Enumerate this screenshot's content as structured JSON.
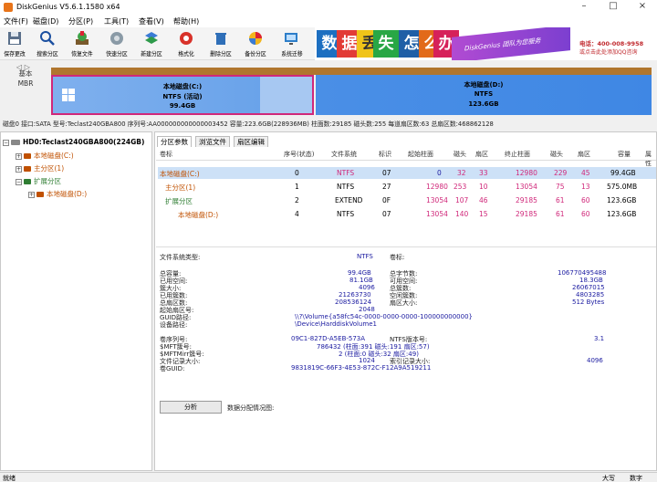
{
  "window": {
    "title": "DiskGenius V5.6.1.1580 x64",
    "minimize": "–",
    "maximize": "□",
    "close": "×"
  },
  "menu": [
    "文件(F)",
    "磁盘(D)",
    "分区(P)",
    "工具(T)",
    "查看(V)",
    "帮助(H)"
  ],
  "toolbar": [
    {
      "label": "保存更改",
      "icon": "save-icon"
    },
    {
      "label": "搜索分区",
      "icon": "search-icon"
    },
    {
      "label": "恢复文件",
      "icon": "recover-icon"
    },
    {
      "label": "快速分区",
      "icon": "quick-partition-icon"
    },
    {
      "label": "新建分区",
      "icon": "new-partition-icon"
    },
    {
      "label": "格式化",
      "icon": "format-icon"
    },
    {
      "label": "删除分区",
      "icon": "delete-icon"
    },
    {
      "label": "备份分区",
      "icon": "backup-icon"
    },
    {
      "label": "系统迁移",
      "icon": "migrate-icon"
    }
  ],
  "banner": {
    "tiles": [
      "数",
      "据",
      "丢",
      "失",
      "怎",
      "么",
      "办"
    ],
    "tile_colors": [
      "#1c6fc1",
      "#e23b36",
      "#f0c419",
      "#28a745",
      "#1f5fa6",
      "#e26a1a",
      "#d6215a"
    ],
    "slogan": "DiskGenius 团队为您服务",
    "phone": "电话：400-008-9958",
    "note": "或点击此处添加QQ咨询"
  },
  "diskmap": {
    "label_lines": [
      "基本",
      "MBR"
    ],
    "partitions": [
      {
        "name": "本地磁盘(C:)",
        "fs": "NTFS (活动)",
        "size": "99.4GB"
      },
      {
        "name": "本地磁盘(D:)",
        "fs": "NTFS",
        "size": "123.6GB"
      }
    ]
  },
  "infoline": "磁盘0 接口:SATA  型号:Teclast240GBA800  序列号:AA000000000000003452  容量:223.6GB(228936MB)  柱面数:29185  磁头数:255  每道扇区数:63  总扇区数:468862128",
  "tree": [
    {
      "label": "HD0:Teclast240GBA800(224GB)",
      "color": "#000000",
      "bold": true
    },
    {
      "label": "本地磁盘(C:)",
      "color": "#c05000",
      "bold": false
    },
    {
      "label": "主分区(1)",
      "color": "#c05000",
      "bold": false
    },
    {
      "label": "扩展分区",
      "color": "#2e7d32",
      "bold": false
    },
    {
      "label": "本地磁盘(D:)",
      "color": "#c05000",
      "bold": false
    }
  ],
  "tabs": [
    "分区参数",
    "浏览文件",
    "扇区编辑"
  ],
  "table": {
    "headers": [
      "卷标",
      "序号(状态)",
      "文件系统",
      "标识",
      "起始柱面",
      "磁头",
      "扇区",
      "终止柱面",
      "磁头",
      "扇区",
      "容量",
      "属性"
    ],
    "rows": [
      [
        "本地磁盘(C:)",
        "0",
        "NTFS",
        "07",
        "0",
        "32",
        "33",
        "12980",
        "229",
        "45",
        "99.4GB",
        ""
      ],
      [
        "主分区(1)",
        "1",
        "NTFS",
        "27",
        "12980",
        "253",
        "10",
        "13054",
        "75",
        "13",
        "575.0MB",
        ""
      ],
      [
        "扩展分区",
        "2",
        "EXTEND",
        "0F",
        "13054",
        "107",
        "46",
        "29185",
        "61",
        "60",
        "123.6GB",
        ""
      ],
      [
        "本地磁盘(D:)",
        "4",
        "NTFS",
        "07",
        "13054",
        "140",
        "15",
        "29185",
        "61",
        "60",
        "123.6GB",
        ""
      ]
    ]
  },
  "details": {
    "fs_type_label": "文件系统类型:",
    "fs_type_value": "NTFS",
    "vol_label": "卷标:",
    "left": [
      [
        "总容量:",
        "99.4GB"
      ],
      [
        "已用空间:",
        "81.1GB"
      ],
      [
        "簇大小:",
        "4096"
      ],
      [
        "已用簇数:",
        "21263730"
      ],
      [
        "总扇区数:",
        "208536124"
      ],
      [
        "起始扇区号:",
        "2048"
      ]
    ],
    "right": [
      [
        "总字节数:",
        "106770495488"
      ],
      [
        "可用空间:",
        "18.3GB"
      ],
      [
        "总簇数:",
        "26067015"
      ],
      [
        "空闲簇数:",
        "4803285"
      ],
      [
        "扇区大小:",
        "512 Bytes"
      ]
    ],
    "guid_path_label": "GUID路径:",
    "guid_path": "\\\\?\\Volume{a58fc54c-0000-0000-0000-100000000000}",
    "device_path_label": "设备路径:",
    "device_path": "\\Device\\HarddiskVolume1",
    "serial_label": "卷序列号:",
    "serial": "09C1-827D-A5EB-573A",
    "ntfs_ver_label": "NTFS版本号:",
    "ntfs_ver": "3.1",
    "mft_label": "$MFT簇号:",
    "mft": "786432 (柱面:391 磁头:191 扇区:57)",
    "mftmirr_label": "$MFTMirr簇号:",
    "mftmirr": "2 (柱面:0 磁头:32 扇区:49)",
    "rec_size_label": "文件记录大小:",
    "rec_size": "1024",
    "idx_size_label": "索引记录大小:",
    "idx_size": "4096",
    "guid_label": "卷GUID:",
    "guid": "9831819C-66F3-4E53-872C-F12A9A519211",
    "analyze_button": "分析",
    "analyze_note": "数据分配情况图:"
  },
  "status": {
    "left": "就绪",
    "caps": "大写",
    "num": "数字"
  }
}
